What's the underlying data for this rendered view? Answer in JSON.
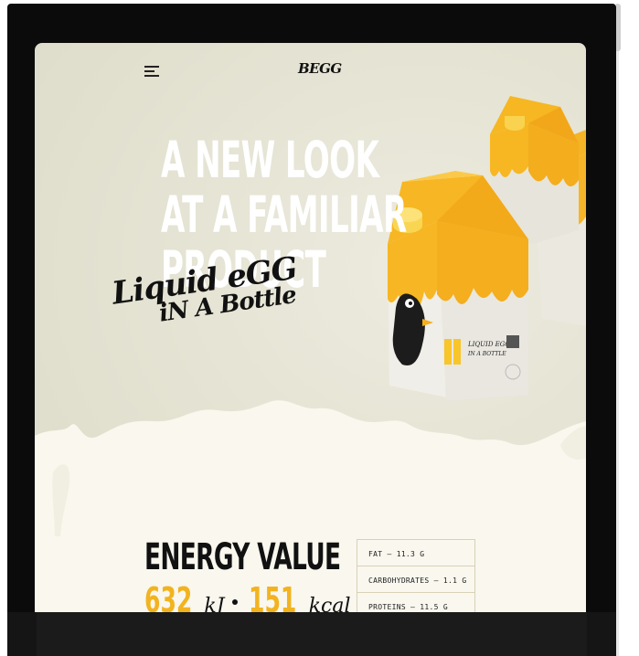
{
  "header": {
    "logo": "BEGG"
  },
  "hero": {
    "headline": [
      "A NEW LOOK",
      "AT A FAMILIAR",
      "PRODUCT"
    ],
    "tagline_line1": "Liquid eGG",
    "tagline_line2": "iN A Bottle"
  },
  "product_label": {
    "brand_text": "LIQUID EGG",
    "sub_text": "IN A BOTTLE"
  },
  "energy": {
    "title": "ENERGY VALUE",
    "kj_value": "632",
    "kj_unit": "kJ",
    "kcal_value": "151",
    "kcal_unit": "kcal"
  },
  "nutrients": [
    "FAT – 11.3 G",
    "CARBOHYDRATES – 1.1 G",
    "PROTEINS – 11.5 G"
  ],
  "colors": {
    "accent_yellow": "#f2b31f",
    "cream": "#f9f7ee",
    "device_frame": "#0b0b0b"
  }
}
